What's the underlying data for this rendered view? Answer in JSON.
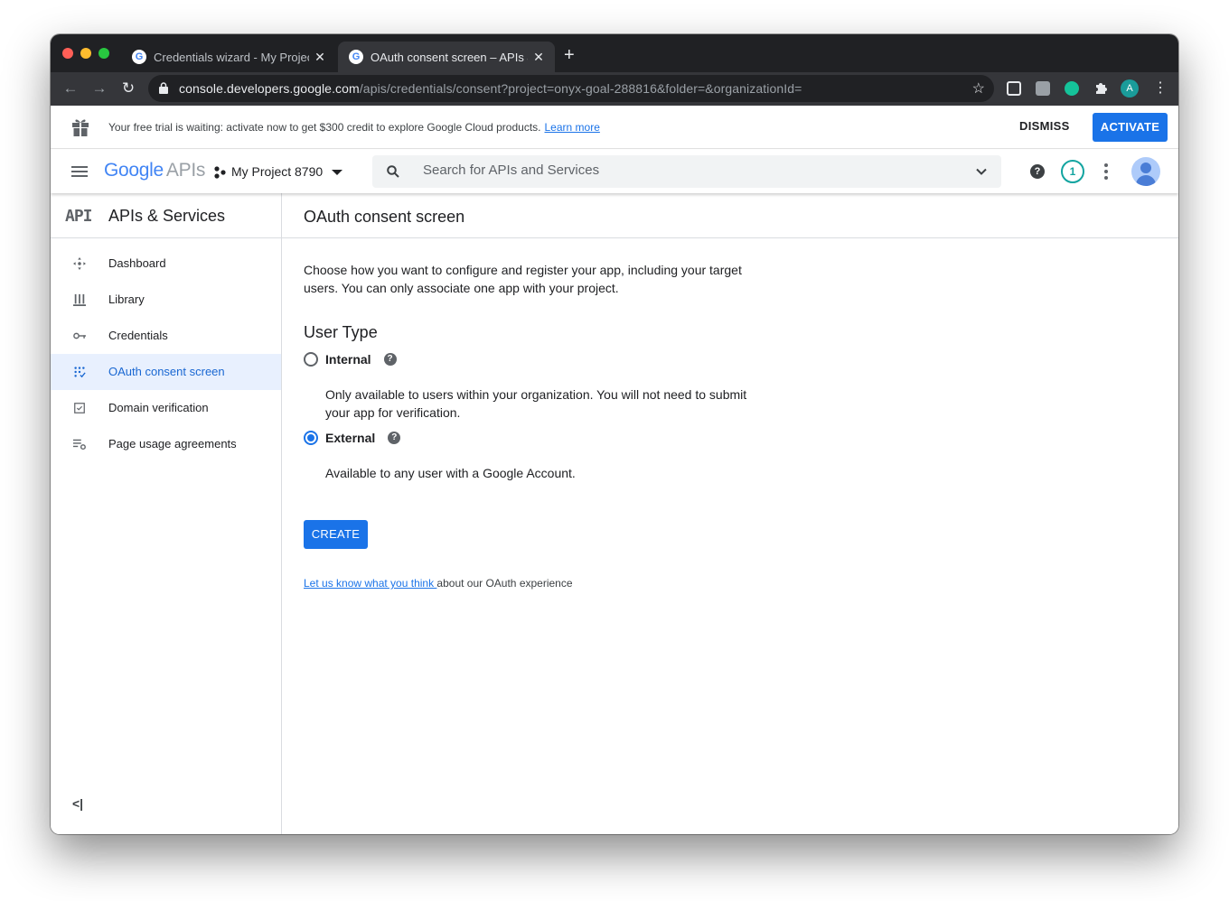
{
  "browser": {
    "tabs": [
      {
        "title": "Credentials wizard - My Project",
        "active": false
      },
      {
        "title": "OAuth consent screen – APIs &",
        "active": true
      }
    ],
    "new_tab": "+",
    "url_host": "console.developers.google.com",
    "url_path": "/apis/credentials/consent?project=onyx-goal-288816&folder=&organizationId=",
    "profile_initial": "A"
  },
  "banner": {
    "text": "Your free trial is waiting: activate now to get $300 credit to explore Google Cloud products.",
    "link": "Learn more",
    "dismiss": "DISMISS",
    "activate": "ACTIVATE"
  },
  "header": {
    "logo_google": "Google",
    "logo_apis": "APIs",
    "project": "My Project 8790",
    "search_placeholder": "Search for APIs and Services",
    "notification_count": "1"
  },
  "sidebar": {
    "glyph": "API",
    "title": "APIs & Services",
    "items": [
      {
        "label": "Dashboard",
        "icon": "dashboard-icon"
      },
      {
        "label": "Library",
        "icon": "library-icon"
      },
      {
        "label": "Credentials",
        "icon": "key-icon"
      },
      {
        "label": "OAuth consent screen",
        "icon": "consent-icon",
        "active": true
      },
      {
        "label": "Domain verification",
        "icon": "checkbox-icon"
      },
      {
        "label": "Page usage agreements",
        "icon": "settings-list-icon"
      }
    ],
    "collapse": "<|"
  },
  "main": {
    "title": "OAuth consent screen",
    "intro": "Choose how you want to configure and register your app, including your target users. You can only associate one app with your project.",
    "user_type_title": "User Type",
    "options": [
      {
        "label": "Internal",
        "description": "Only available to users within your organization. You will not need to submit your app for verification.",
        "selected": false
      },
      {
        "label": "External",
        "description": "Available to any user with a Google Account.",
        "selected": true
      }
    ],
    "create": "CREATE",
    "feedback_link": "Let us know what you think ",
    "feedback_text": "about our OAuth experience"
  },
  "colors": {
    "accent": "#1a73e8",
    "tabstrip": "#202124",
    "toolbar": "#35363a",
    "active_nav_bg": "#e8f0fe"
  }
}
